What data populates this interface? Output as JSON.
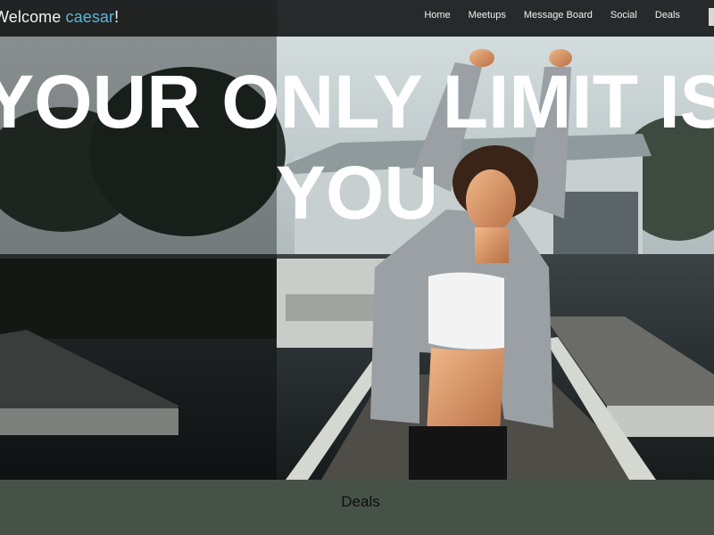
{
  "header": {
    "welcome_prefix": "Welcome ",
    "username": "caesar",
    "welcome_suffix": "!",
    "nav": [
      {
        "label": "Home"
      },
      {
        "label": "Meetups"
      },
      {
        "label": "Message Board"
      },
      {
        "label": "Social"
      },
      {
        "label": "Deals"
      }
    ]
  },
  "hero": {
    "headline_line1": "YOUR ONLY LIMIT IS",
    "headline_line2": "YOU",
    "image": "woman-stretching-on-dock-photo"
  },
  "section": {
    "title": "Deals"
  },
  "colors": {
    "navbar_bg": "#181a1a",
    "username_accent": "#5bb6d9",
    "section_bg": "#465247",
    "headline_text": "#ffffff"
  }
}
